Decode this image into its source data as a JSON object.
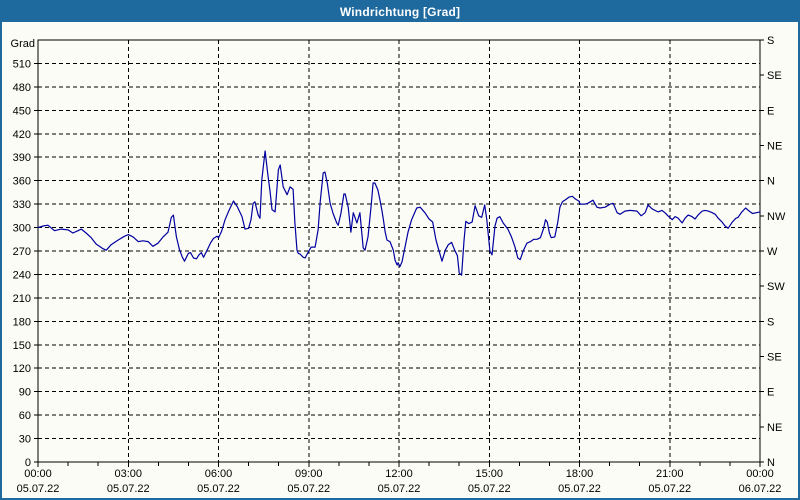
{
  "window": {
    "title": "Windrichtung [Grad]"
  },
  "colors": {
    "title_bar": "#1E699E",
    "window_border": "#1E699E",
    "background": "#FCFCF6",
    "line": "#0000A0",
    "grid": "#000000",
    "text": "#000000"
  },
  "chart_data": {
    "type": "line",
    "title": "Windrichtung [Grad]",
    "grid": "dashed",
    "ylim": [
      0,
      540
    ],
    "y_axis_left": {
      "label": "Grad",
      "ticks": [
        0,
        30,
        60,
        90,
        120,
        150,
        180,
        210,
        240,
        270,
        300,
        330,
        360,
        390,
        420,
        450,
        480,
        510
      ]
    },
    "y_axis_right": {
      "ticks": [
        {
          "deg": 540,
          "label": "S"
        },
        {
          "deg": 495,
          "label": "SE"
        },
        {
          "deg": 450,
          "label": "E"
        },
        {
          "deg": 405,
          "label": "NE"
        },
        {
          "deg": 360,
          "label": "N"
        },
        {
          "deg": 315,
          "label": "NW"
        },
        {
          "deg": 270,
          "label": "W"
        },
        {
          "deg": 225,
          "label": "SW"
        },
        {
          "deg": 180,
          "label": "S"
        },
        {
          "deg": 135,
          "label": "SE"
        },
        {
          "deg": 90,
          "label": "E"
        },
        {
          "deg": 45,
          "label": "NE"
        },
        {
          "deg": 0,
          "label": "N"
        }
      ]
    },
    "x_axis": {
      "hours_span": 24,
      "minor_tick_hours": 1,
      "ticks": [
        {
          "hour": 0,
          "time": "00:00",
          "date": "05.07.22"
        },
        {
          "hour": 3,
          "time": "03:00",
          "date": "05.07.22"
        },
        {
          "hour": 6,
          "time": "06:00",
          "date": "05.07.22"
        },
        {
          "hour": 9,
          "time": "09:00",
          "date": "05.07.22"
        },
        {
          "hour": 12,
          "time": "12:00",
          "date": "05.07.22"
        },
        {
          "hour": 15,
          "time": "15:00",
          "date": "05.07.22"
        },
        {
          "hour": 18,
          "time": "18:00",
          "date": "05.07.22"
        },
        {
          "hour": 21,
          "time": "21:00",
          "date": "05.07.22"
        },
        {
          "hour": 24,
          "time": "00:00",
          "date": "06.07.22"
        }
      ]
    },
    "series": [
      {
        "name": "Windrichtung",
        "color": "#0000A0",
        "points": [
          [
            0.0,
            300
          ],
          [
            0.17,
            302
          ],
          [
            0.33,
            303
          ],
          [
            0.55,
            296
          ],
          [
            0.77,
            298
          ],
          [
            1.0,
            297
          ],
          [
            1.16,
            293
          ],
          [
            1.33,
            296
          ],
          [
            1.44,
            298
          ],
          [
            1.6,
            293
          ],
          [
            1.77,
            287
          ],
          [
            1.93,
            279
          ],
          [
            2.16,
            273
          ],
          [
            2.27,
            271
          ],
          [
            2.43,
            278
          ],
          [
            2.66,
            284
          ],
          [
            2.88,
            289
          ],
          [
            3.0,
            291
          ],
          [
            3.16,
            288
          ],
          [
            3.33,
            282
          ],
          [
            3.49,
            283
          ],
          [
            3.66,
            282
          ],
          [
            3.82,
            276
          ],
          [
            3.99,
            280
          ],
          [
            4.16,
            288
          ],
          [
            4.32,
            294
          ],
          [
            4.43,
            313
          ],
          [
            4.5,
            316
          ],
          [
            4.6,
            288
          ],
          [
            4.7,
            272
          ],
          [
            4.8,
            262
          ],
          [
            4.87,
            257
          ],
          [
            5.0,
            267
          ],
          [
            5.07,
            268
          ],
          [
            5.17,
            261
          ],
          [
            5.27,
            260
          ],
          [
            5.35,
            265
          ],
          [
            5.43,
            268
          ],
          [
            5.5,
            262
          ],
          [
            5.62,
            271
          ],
          [
            5.73,
            280
          ],
          [
            5.83,
            286
          ],
          [
            5.95,
            289
          ],
          [
            6.0,
            287
          ],
          [
            6.1,
            295
          ],
          [
            6.22,
            310
          ],
          [
            6.35,
            322
          ],
          [
            6.5,
            334
          ],
          [
            6.62,
            327
          ],
          [
            6.78,
            314
          ],
          [
            6.88,
            298
          ],
          [
            7.0,
            299
          ],
          [
            7.08,
            310
          ],
          [
            7.15,
            331
          ],
          [
            7.21,
            333
          ],
          [
            7.32,
            316
          ],
          [
            7.38,
            312
          ],
          [
            7.44,
            361
          ],
          [
            7.55,
            398
          ],
          [
            7.65,
            365
          ],
          [
            7.71,
            348
          ],
          [
            7.78,
            323
          ],
          [
            7.88,
            320
          ],
          [
            7.99,
            374
          ],
          [
            8.05,
            380
          ],
          [
            8.15,
            352
          ],
          [
            8.28,
            342
          ],
          [
            8.38,
            352
          ],
          [
            8.48,
            349
          ],
          [
            8.54,
            306
          ],
          [
            8.61,
            271
          ],
          [
            8.65,
            267
          ],
          [
            8.71,
            266
          ],
          [
            8.82,
            262
          ],
          [
            8.88,
            261
          ],
          [
            9.0,
            270
          ],
          [
            9.08,
            275
          ],
          [
            9.21,
            275
          ],
          [
            9.31,
            297
          ],
          [
            9.38,
            333
          ],
          [
            9.48,
            370
          ],
          [
            9.54,
            371
          ],
          [
            9.62,
            356
          ],
          [
            9.71,
            331
          ],
          [
            9.81,
            318
          ],
          [
            9.93,
            306
          ],
          [
            9.98,
            303
          ],
          [
            10.07,
            318
          ],
          [
            10.17,
            343
          ],
          [
            10.21,
            343
          ],
          [
            10.31,
            326
          ],
          [
            10.4,
            294
          ],
          [
            10.48,
            319
          ],
          [
            10.6,
            306
          ],
          [
            10.7,
            319
          ],
          [
            10.81,
            274
          ],
          [
            10.87,
            271
          ],
          [
            10.97,
            288
          ],
          [
            11.08,
            330
          ],
          [
            11.14,
            357
          ],
          [
            11.2,
            357
          ],
          [
            11.3,
            348
          ],
          [
            11.37,
            335
          ],
          [
            11.43,
            322
          ],
          [
            11.48,
            310
          ],
          [
            11.54,
            294
          ],
          [
            11.6,
            284
          ],
          [
            11.7,
            282
          ],
          [
            11.81,
            271
          ],
          [
            11.87,
            258
          ],
          [
            11.94,
            252
          ],
          [
            11.97,
            255
          ],
          [
            12.03,
            250
          ],
          [
            12.1,
            256
          ],
          [
            12.2,
            275
          ],
          [
            12.3,
            294
          ],
          [
            12.42,
            310
          ],
          [
            12.59,
            325
          ],
          [
            12.7,
            326
          ],
          [
            12.86,
            319
          ],
          [
            13.0,
            311
          ],
          [
            13.12,
            307
          ],
          [
            13.23,
            284
          ],
          [
            13.34,
            269
          ],
          [
            13.43,
            257
          ],
          [
            13.54,
            271
          ],
          [
            13.64,
            278
          ],
          [
            13.75,
            281
          ],
          [
            13.85,
            271
          ],
          [
            13.94,
            264
          ],
          [
            14.0,
            242
          ],
          [
            14.08,
            239
          ],
          [
            14.16,
            283
          ],
          [
            14.22,
            308
          ],
          [
            14.32,
            305
          ],
          [
            14.43,
            307
          ],
          [
            14.53,
            328
          ],
          [
            14.65,
            315
          ],
          [
            14.75,
            313
          ],
          [
            14.85,
            329
          ],
          [
            14.92,
            310
          ],
          [
            15.02,
            270
          ],
          [
            15.09,
            265
          ],
          [
            15.19,
            302
          ],
          [
            15.26,
            312
          ],
          [
            15.35,
            314
          ],
          [
            15.46,
            306
          ],
          [
            15.62,
            298
          ],
          [
            15.73,
            289
          ],
          [
            15.85,
            276
          ],
          [
            15.95,
            261
          ],
          [
            16.03,
            259
          ],
          [
            16.14,
            271
          ],
          [
            16.25,
            280
          ],
          [
            16.37,
            282
          ],
          [
            16.48,
            285
          ],
          [
            16.59,
            285
          ],
          [
            16.7,
            287
          ],
          [
            16.8,
            298
          ],
          [
            16.87,
            310
          ],
          [
            16.93,
            307
          ],
          [
            17.0,
            293
          ],
          [
            17.06,
            287
          ],
          [
            17.18,
            288
          ],
          [
            17.28,
            307
          ],
          [
            17.35,
            326
          ],
          [
            17.43,
            333
          ],
          [
            17.55,
            336
          ],
          [
            17.65,
            339
          ],
          [
            17.76,
            340
          ],
          [
            17.88,
            336
          ],
          [
            17.98,
            334
          ],
          [
            18.02,
            330
          ],
          [
            18.18,
            330
          ],
          [
            18.28,
            331
          ],
          [
            18.45,
            335
          ],
          [
            18.58,
            326
          ],
          [
            18.68,
            325
          ],
          [
            18.85,
            326
          ],
          [
            19.02,
            330
          ],
          [
            19.12,
            331
          ],
          [
            19.25,
            319
          ],
          [
            19.35,
            317
          ],
          [
            19.51,
            321
          ],
          [
            19.68,
            322
          ],
          [
            19.91,
            321
          ],
          [
            20.05,
            315
          ],
          [
            20.18,
            319
          ],
          [
            20.28,
            329
          ],
          [
            20.41,
            324
          ],
          [
            20.51,
            322
          ],
          [
            20.61,
            320
          ],
          [
            20.74,
            322
          ],
          [
            20.84,
            319
          ],
          [
            20.94,
            315
          ],
          [
            21.08,
            310
          ],
          [
            21.18,
            314
          ],
          [
            21.28,
            312
          ],
          [
            21.41,
            306
          ],
          [
            21.51,
            312
          ],
          [
            21.61,
            316
          ],
          [
            21.74,
            314
          ],
          [
            21.84,
            311
          ],
          [
            21.94,
            316
          ],
          [
            22.08,
            321
          ],
          [
            22.18,
            322
          ],
          [
            22.28,
            321
          ],
          [
            22.41,
            319
          ],
          [
            22.51,
            317
          ],
          [
            22.61,
            312
          ],
          [
            22.74,
            307
          ],
          [
            22.84,
            302
          ],
          [
            22.94,
            299
          ],
          [
            23.08,
            307
          ],
          [
            23.2,
            312
          ],
          [
            23.27,
            313
          ],
          [
            23.4,
            320
          ],
          [
            23.52,
            325
          ],
          [
            23.64,
            321
          ],
          [
            23.75,
            318
          ],
          [
            23.88,
            319
          ],
          [
            24.0,
            320
          ]
        ]
      }
    ]
  }
}
